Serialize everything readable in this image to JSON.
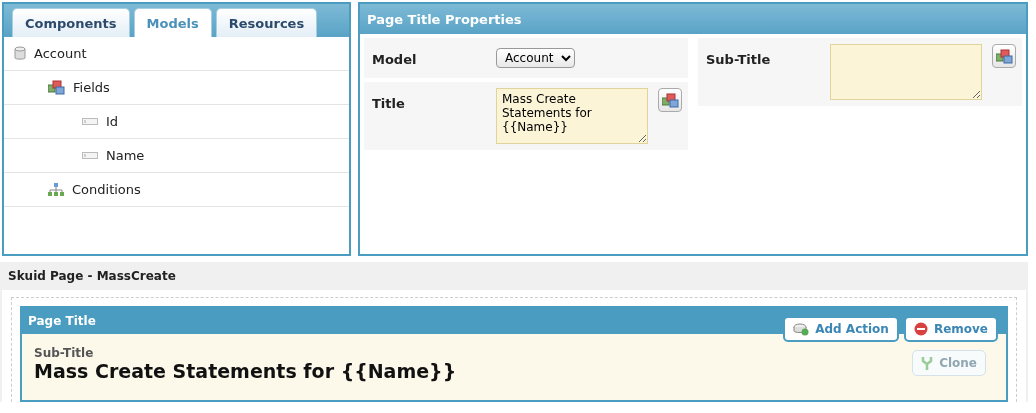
{
  "tabs": [
    {
      "label": "Components",
      "selected": false
    },
    {
      "label": "Models",
      "selected": true
    },
    {
      "label": "Resources",
      "selected": false
    }
  ],
  "tree": [
    {
      "label": "Account",
      "kind": "model",
      "children": [
        {
          "label": "Fields",
          "kind": "fields",
          "children": [
            {
              "label": "Id",
              "kind": "field"
            },
            {
              "label": "Name",
              "kind": "field"
            }
          ]
        },
        {
          "label": "Conditions",
          "kind": "conditions"
        }
      ]
    }
  ],
  "properties": {
    "title": "Page Title Properties",
    "left_rows": [
      {
        "label": "Model",
        "kind": "select",
        "value": "Account"
      },
      {
        "label": "Title",
        "kind": "textarea",
        "value": "Mass Create Statements for {{Name}}"
      }
    ],
    "right_rows": [
      {
        "label": "Sub-Title",
        "kind": "textarea"
      }
    ]
  },
  "page": {
    "title": "Skuid Page - MassCreate",
    "component": {
      "header": "Page Title",
      "subtitle": "Sub-Title",
      "title": "Mass Create Statements for {{Name}}",
      "actions": [
        {
          "label": "Add Action",
          "kind": "add",
          "disabled": false
        },
        {
          "label": "Remove",
          "kind": "remove",
          "disabled": false
        },
        {
          "label": "Clone",
          "kind": "clone",
          "disabled": true
        }
      ]
    }
  }
}
